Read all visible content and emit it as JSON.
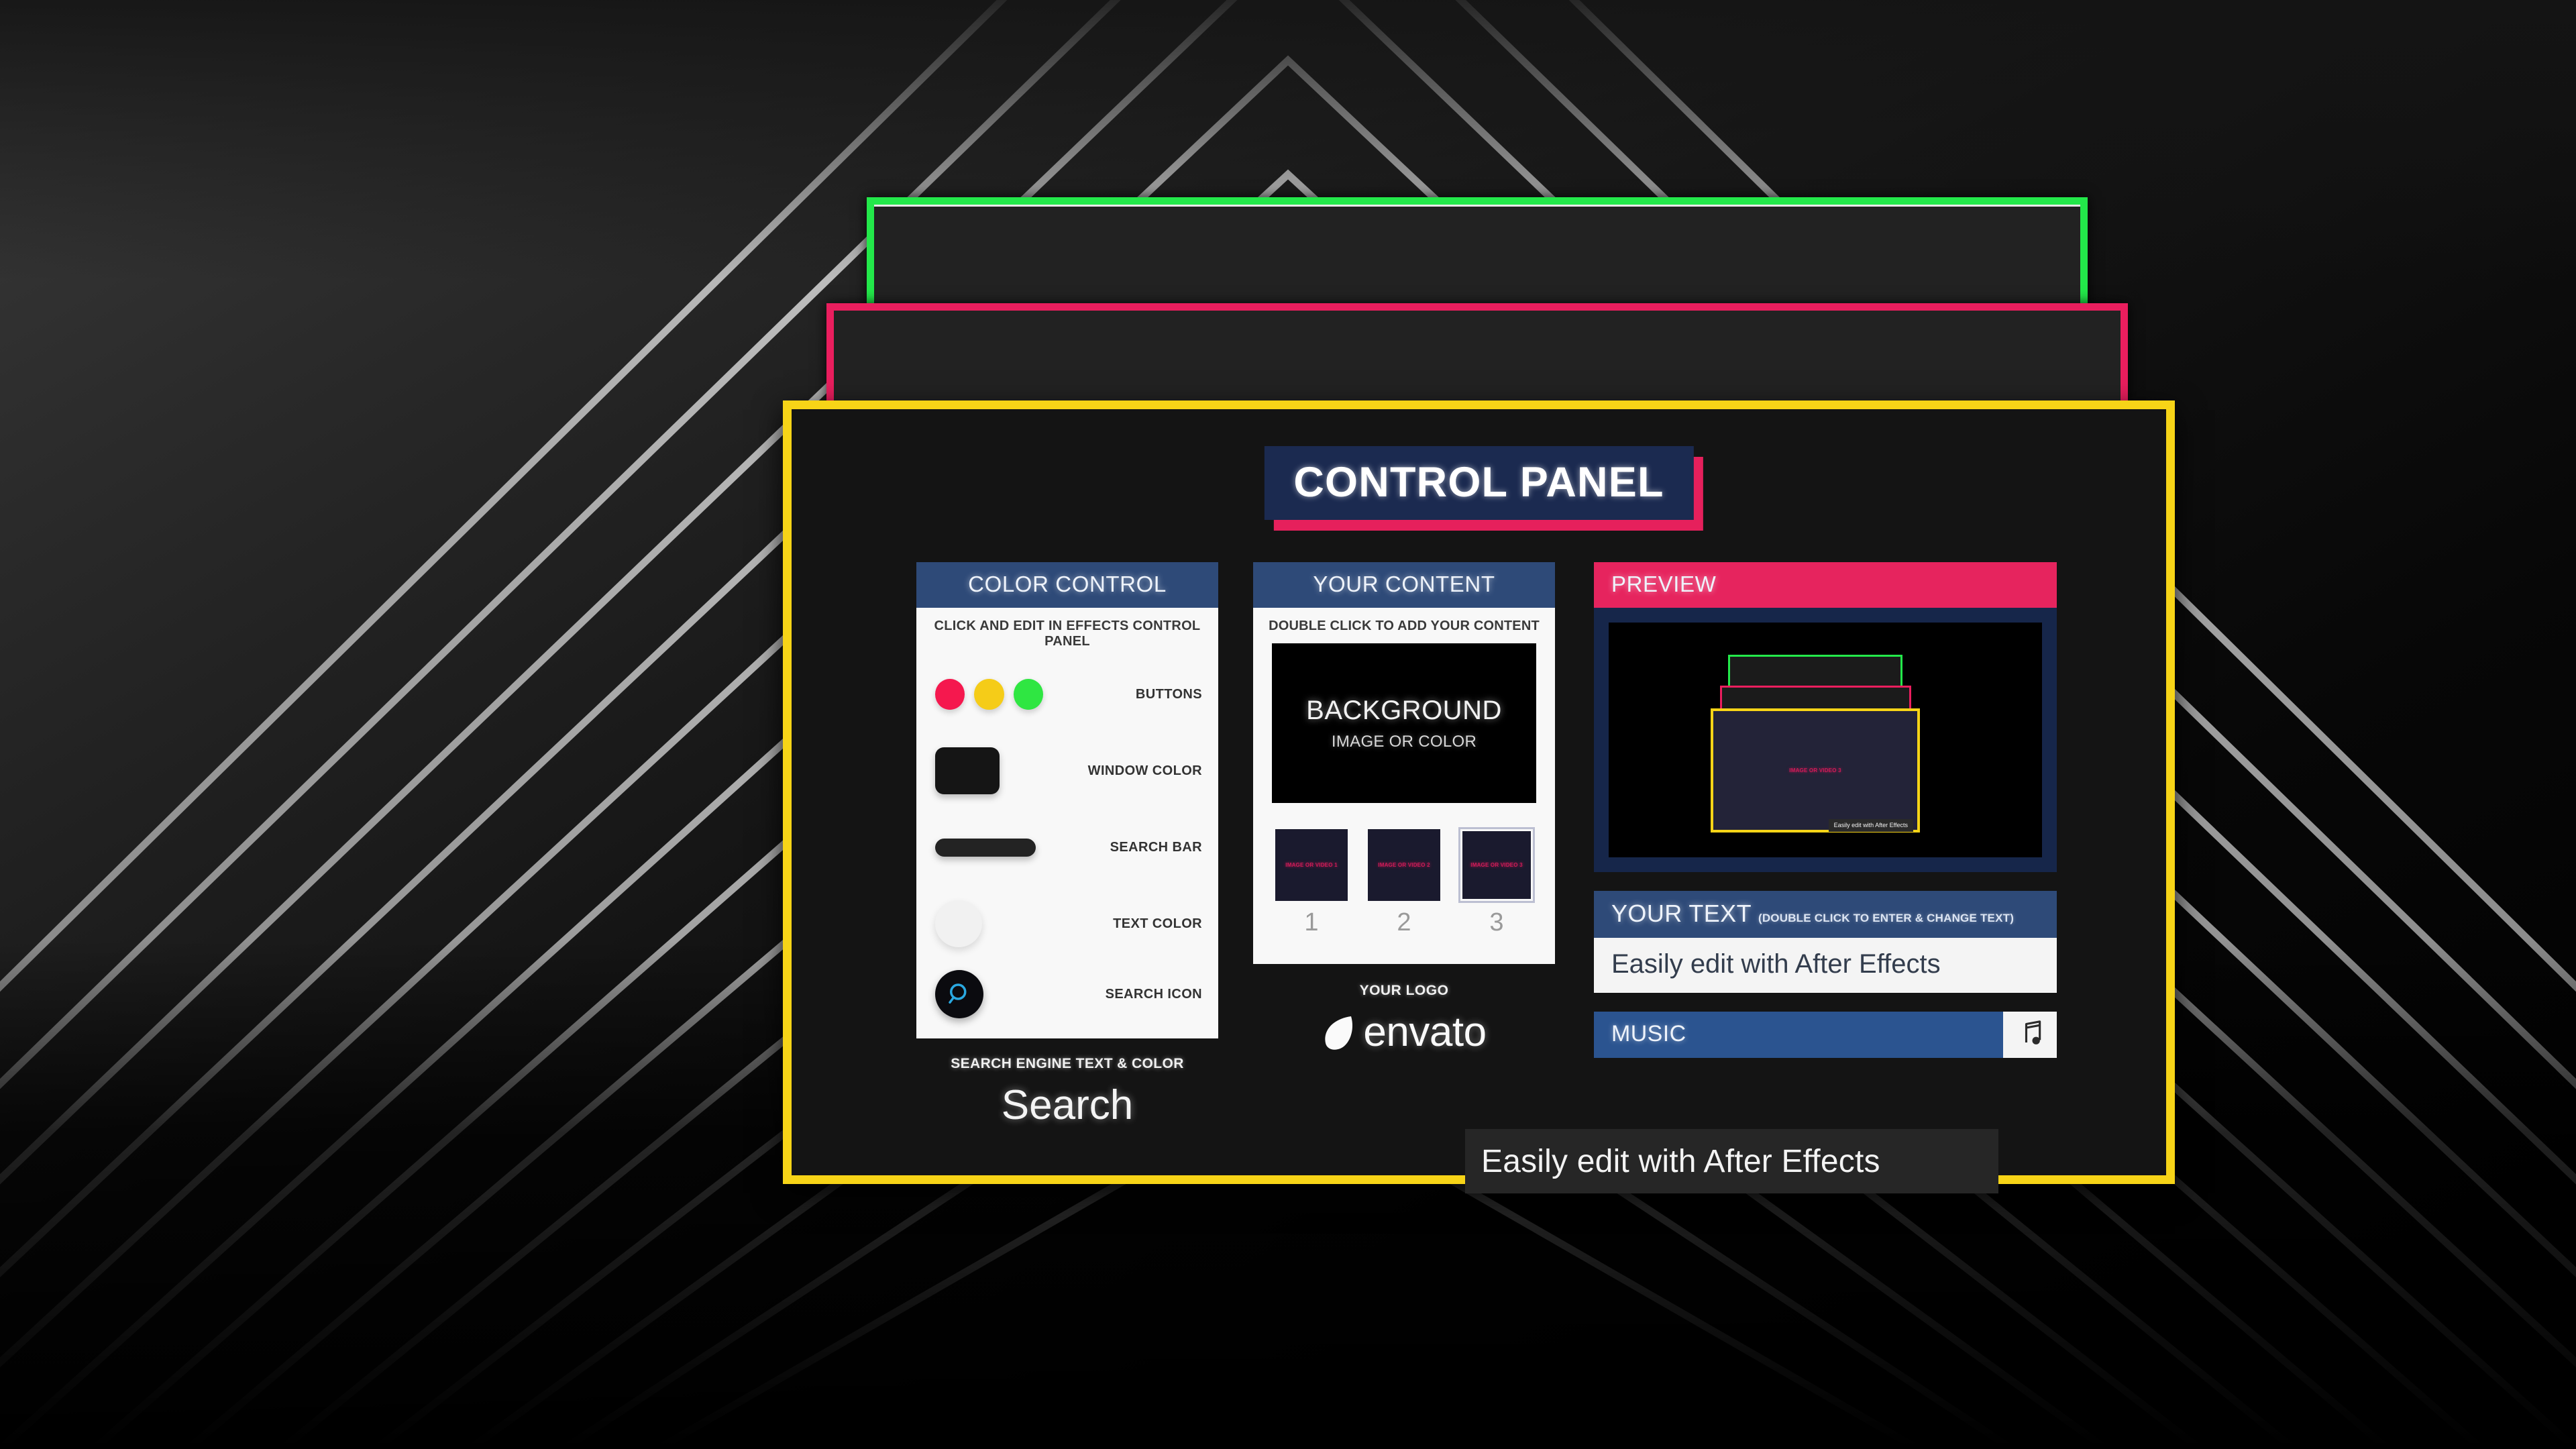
{
  "window": {
    "title": "CONTROL PANEL",
    "accent_yellow": "#f7d417",
    "accent_pink": "#e6245e",
    "accent_green": "#23e84a",
    "accent_navy": "#2e4a78"
  },
  "color_control": {
    "header": "COLOR CONTROL",
    "subtitle": "CLICK AND EDIT IN EFFECTS CONTROL PANEL",
    "rows": [
      {
        "label": "BUTTONS",
        "swatch": "three-dots",
        "colors": [
          "#f5184e",
          "#f5cc18",
          "#2fe642"
        ]
      },
      {
        "label": "WINDOW COLOR",
        "swatch": "rounded-rect",
        "colors": [
          "#151515"
        ]
      },
      {
        "label": "SEARCH BAR",
        "swatch": "pill",
        "colors": [
          "#232323"
        ]
      },
      {
        "label": "TEXT COLOR",
        "swatch": "circle",
        "colors": [
          "#f1f1f1"
        ]
      },
      {
        "label": "SEARCH ICON",
        "swatch": "icon-circle",
        "colors": [
          "#0b0b0f",
          "#2aa8e0"
        ]
      }
    ],
    "footer_label": "SEARCH ENGINE TEXT & COLOR",
    "footer_value": "Search"
  },
  "your_content": {
    "header": "YOUR CONTENT",
    "subtitle": "DOUBLE CLICK TO ADD YOUR CONTENT",
    "background_box": {
      "title": "BACKGROUND",
      "subtitle": "IMAGE OR COLOR"
    },
    "thumbnails": [
      {
        "number": "1",
        "caption": "IMAGE OR VIDEO 1",
        "selected": false
      },
      {
        "number": "2",
        "caption": "IMAGE OR VIDEO 2",
        "selected": false
      },
      {
        "number": "3",
        "caption": "IMAGE OR VIDEO 3",
        "selected": true
      }
    ],
    "logo_label": "YOUR LOGO",
    "logo_text": "envato"
  },
  "preview": {
    "header": "PREVIEW",
    "mini": {
      "content_label": "IMAGE OR VIDEO 3",
      "caption": "Easily edit with After Effects"
    }
  },
  "your_text": {
    "header_title": "YOUR TEXT",
    "header_hint": "(DOUBLE CLICK TO ENTER & CHANGE TEXT)",
    "value": "Easily edit with After Effects"
  },
  "music": {
    "label": "MUSIC",
    "button_icon": "music-note-icon"
  },
  "caption_overlay": {
    "text": "Easily edit with After Effects"
  }
}
